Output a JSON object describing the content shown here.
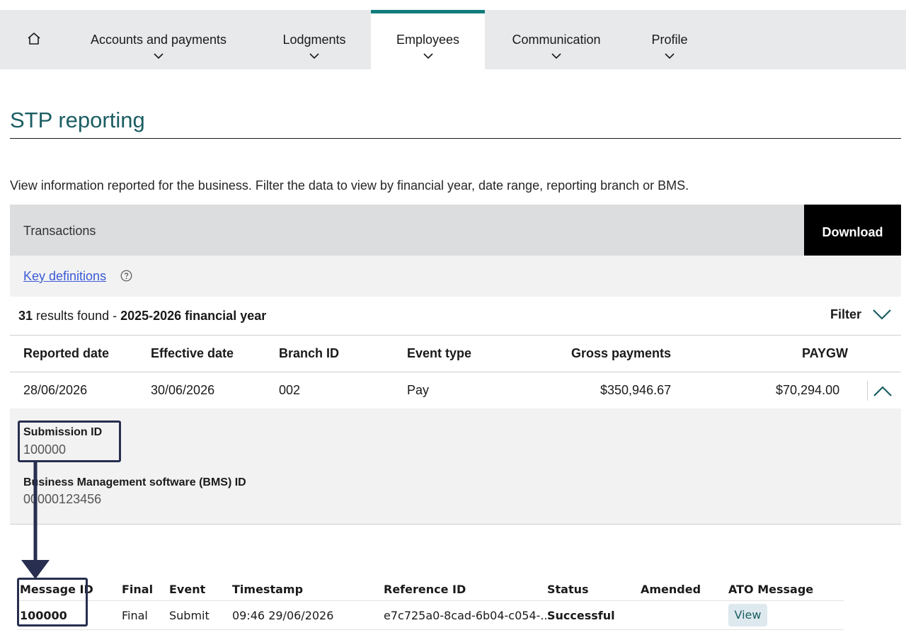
{
  "nav": {
    "items": [
      {
        "label": "Accounts and payments"
      },
      {
        "label": "Lodgments"
      },
      {
        "label": "Employees"
      },
      {
        "label": "Communication"
      },
      {
        "label": "Profile"
      }
    ]
  },
  "page": {
    "title": "STP reporting",
    "intro": "View information reported for the business. Filter the data to view by financial year, date range, reporting branch or BMS."
  },
  "transactions": {
    "title": "Transactions",
    "download_label": "Download",
    "key_definitions": "Key definitions",
    "results_count": "31",
    "results_text": " results found - ",
    "results_period": "2025-2026 financial year",
    "filter_label": "Filter"
  },
  "table": {
    "headers": [
      "Reported date",
      "Effective date",
      "Branch ID",
      "Event type",
      "Gross payments",
      "PAYGW"
    ],
    "row": [
      "28/06/2026",
      "30/06/2026",
      "002",
      "Pay",
      "$350,946.67",
      "$70,294.00"
    ]
  },
  "detail": {
    "submission_label": "Submission ID",
    "submission_value": "100000",
    "bms_label": "Business Management software (BMS) ID",
    "bms_value": "00000123456"
  },
  "messages": {
    "headers": [
      "Message ID",
      "Final",
      "Event",
      "Timestamp",
      "Reference ID",
      "Status",
      "Amended",
      "ATO Message"
    ],
    "row": [
      "100000",
      "Final",
      "Submit",
      "09:46 29/06/2026",
      "e7c725a0-8cad-6b04-c054-...",
      "Successful",
      "",
      "View"
    ]
  },
  "colors": {
    "accent": "#127c7c",
    "title": "#1b5e63",
    "link": "#3b5bd6",
    "highlight": "#272e4f"
  }
}
